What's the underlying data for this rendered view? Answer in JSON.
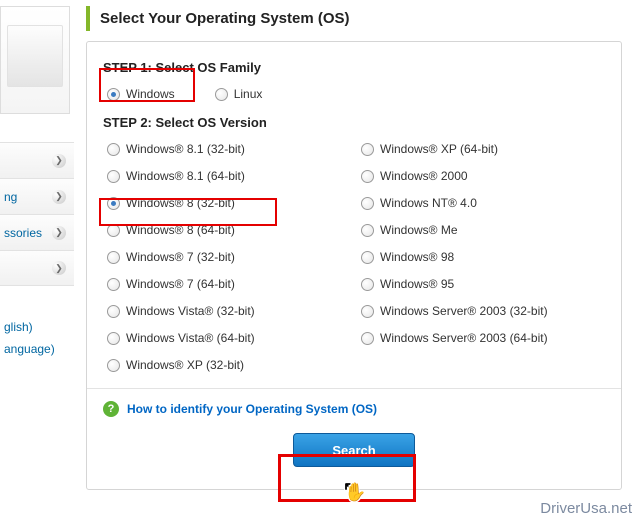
{
  "sidebar": {
    "items": [
      {
        "label": ""
      },
      {
        "label": "ng"
      },
      {
        "label": "ssories"
      },
      {
        "label": ""
      }
    ],
    "lang_label": "glish)",
    "lang_change": "anguage)"
  },
  "title": "Select Your Operating System (OS)",
  "step1": {
    "title": "STEP 1: Select OS Family",
    "options": [
      {
        "label": "Windows",
        "selected": true
      },
      {
        "label": "Linux",
        "selected": false
      }
    ]
  },
  "step2": {
    "title": "STEP 2: Select OS Version",
    "left": [
      {
        "label": "Windows® 8.1 (32-bit)",
        "selected": false
      },
      {
        "label": "Windows® 8.1 (64-bit)",
        "selected": false
      },
      {
        "label": "Windows® 8 (32-bit)",
        "selected": true
      },
      {
        "label": "Windows® 8 (64-bit)",
        "selected": false
      },
      {
        "label": "Windows® 7 (32-bit)",
        "selected": false
      },
      {
        "label": "Windows® 7 (64-bit)",
        "selected": false
      },
      {
        "label": "Windows Vista® (32-bit)",
        "selected": false
      },
      {
        "label": "Windows Vista® (64-bit)",
        "selected": false
      },
      {
        "label": "Windows® XP (32-bit)",
        "selected": false
      }
    ],
    "right": [
      {
        "label": "Windows® XP (64-bit)",
        "selected": false
      },
      {
        "label": "Windows® 2000",
        "selected": false
      },
      {
        "label": "Windows NT® 4.0",
        "selected": false
      },
      {
        "label": "Windows® Me",
        "selected": false
      },
      {
        "label": "Windows® 98",
        "selected": false
      },
      {
        "label": "Windows® 95",
        "selected": false
      },
      {
        "label": "Windows Server® 2003 (32-bit)",
        "selected": false
      },
      {
        "label": "Windows Server® 2003 (64-bit)",
        "selected": false
      }
    ]
  },
  "help_link": "How to identify your Operating System (OS)",
  "search_label": "Search",
  "watermark": "DriverUsa.net"
}
